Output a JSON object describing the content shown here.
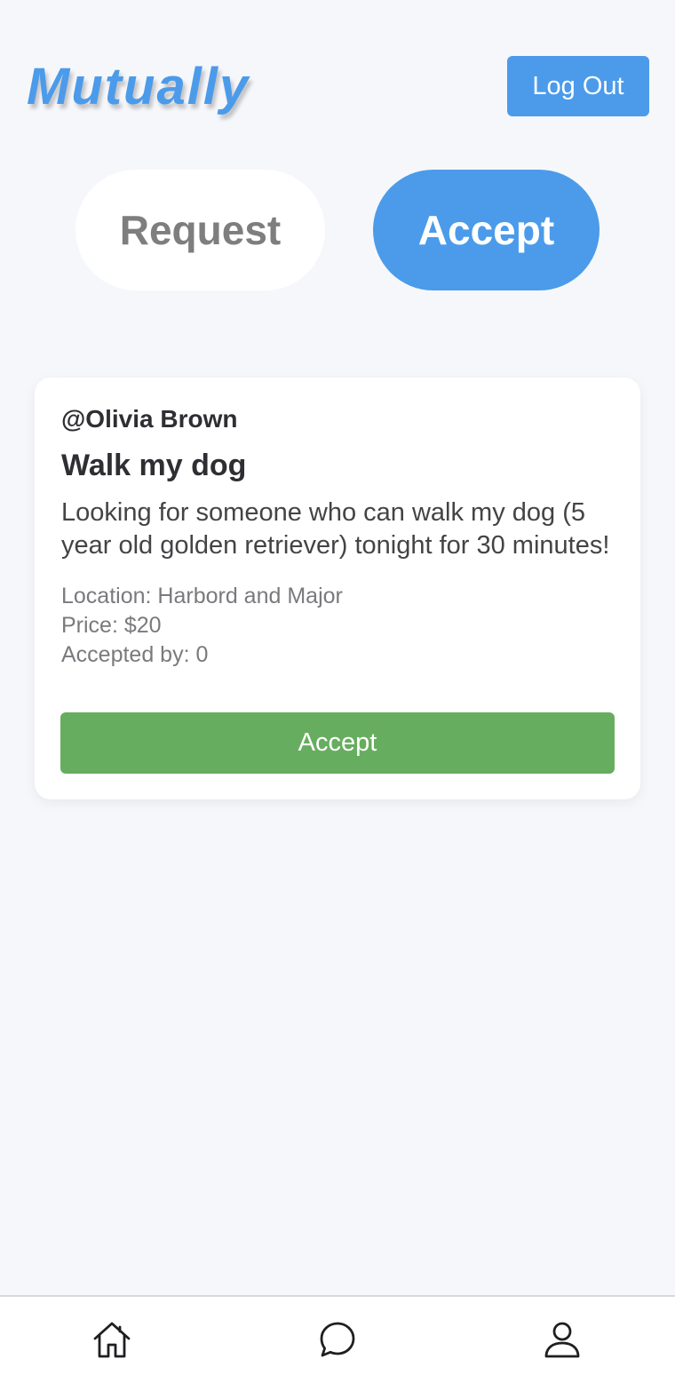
{
  "header": {
    "app_title": "Mutually",
    "logout_label": "Log Out"
  },
  "tabs": {
    "request_label": "Request",
    "accept_label": "Accept",
    "active": "Accept"
  },
  "posts": [
    {
      "user": "@Olivia Brown",
      "title": "Walk my dog",
      "description": "Looking for someone who can walk my dog (5 year old golden retriever) tonight for 30 minutes!",
      "location_line": "Location: Harbord and Major",
      "price_line": "Price: $20",
      "accepted_line": "Accepted by: 0",
      "accept_label": "Accept"
    }
  ],
  "bottom_nav": {
    "items": [
      {
        "icon": "home-icon"
      },
      {
        "icon": "chat-icon"
      },
      {
        "icon": "profile-icon"
      }
    ]
  },
  "colors": {
    "accent": "#4b9bea",
    "accept_green": "#67ad5f",
    "background": "#f6f7fb"
  }
}
